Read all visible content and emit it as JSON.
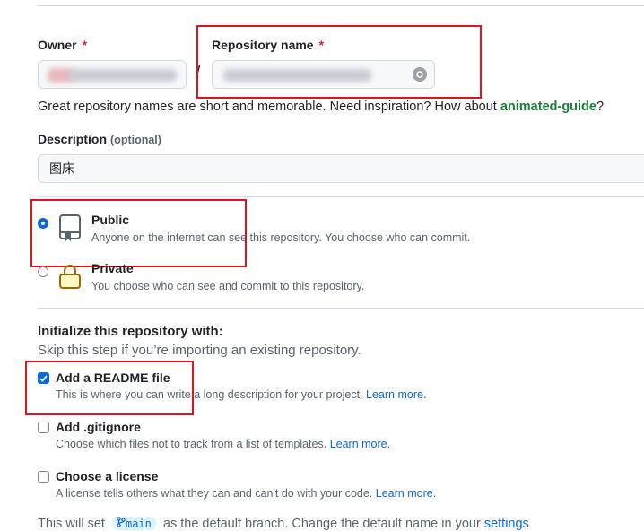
{
  "owner": {
    "label": "Owner",
    "required_mark": "*"
  },
  "repo_name": {
    "label": "Repository name",
    "required_mark": "*",
    "separator": "/"
  },
  "name_hint": {
    "text": "Great repository names are short and memorable. Need inspiration? How about ",
    "suggestion": "animated-guide",
    "end": "?"
  },
  "description": {
    "label": "Description",
    "optional": "(optional)",
    "value": "图床"
  },
  "visibility": {
    "public": {
      "title": "Public",
      "desc": "Anyone on the internet can see this repository. You choose who can commit.",
      "selected": true
    },
    "private": {
      "title": "Private",
      "desc": "You choose who can see and commit to this repository.",
      "selected": false
    }
  },
  "init": {
    "title": "Initialize this repository with:",
    "subtitle": "Skip this step if you’re importing an existing repository.",
    "readme": {
      "title": "Add a README file",
      "desc": "This is where you can write a long description for your project.",
      "link": "Learn more.",
      "checked": true
    },
    "gitignore": {
      "title": "Add .gitignore",
      "desc": "Choose which files not to track from a list of templates.",
      "link": "Learn more.",
      "checked": false
    },
    "license": {
      "title": "Choose a license",
      "desc": "A license tells others what they can and can't do with your code.",
      "link": "Learn more.",
      "checked": false
    }
  },
  "footer": {
    "prefix": "This will set",
    "branch": "main",
    "middle": "as the default branch. Change the default name in your",
    "link": "settings"
  },
  "colors": {
    "accent": "#0969da",
    "success": "#1a7f37",
    "danger": "#d1242f",
    "highlight_box": "#e0141e"
  }
}
